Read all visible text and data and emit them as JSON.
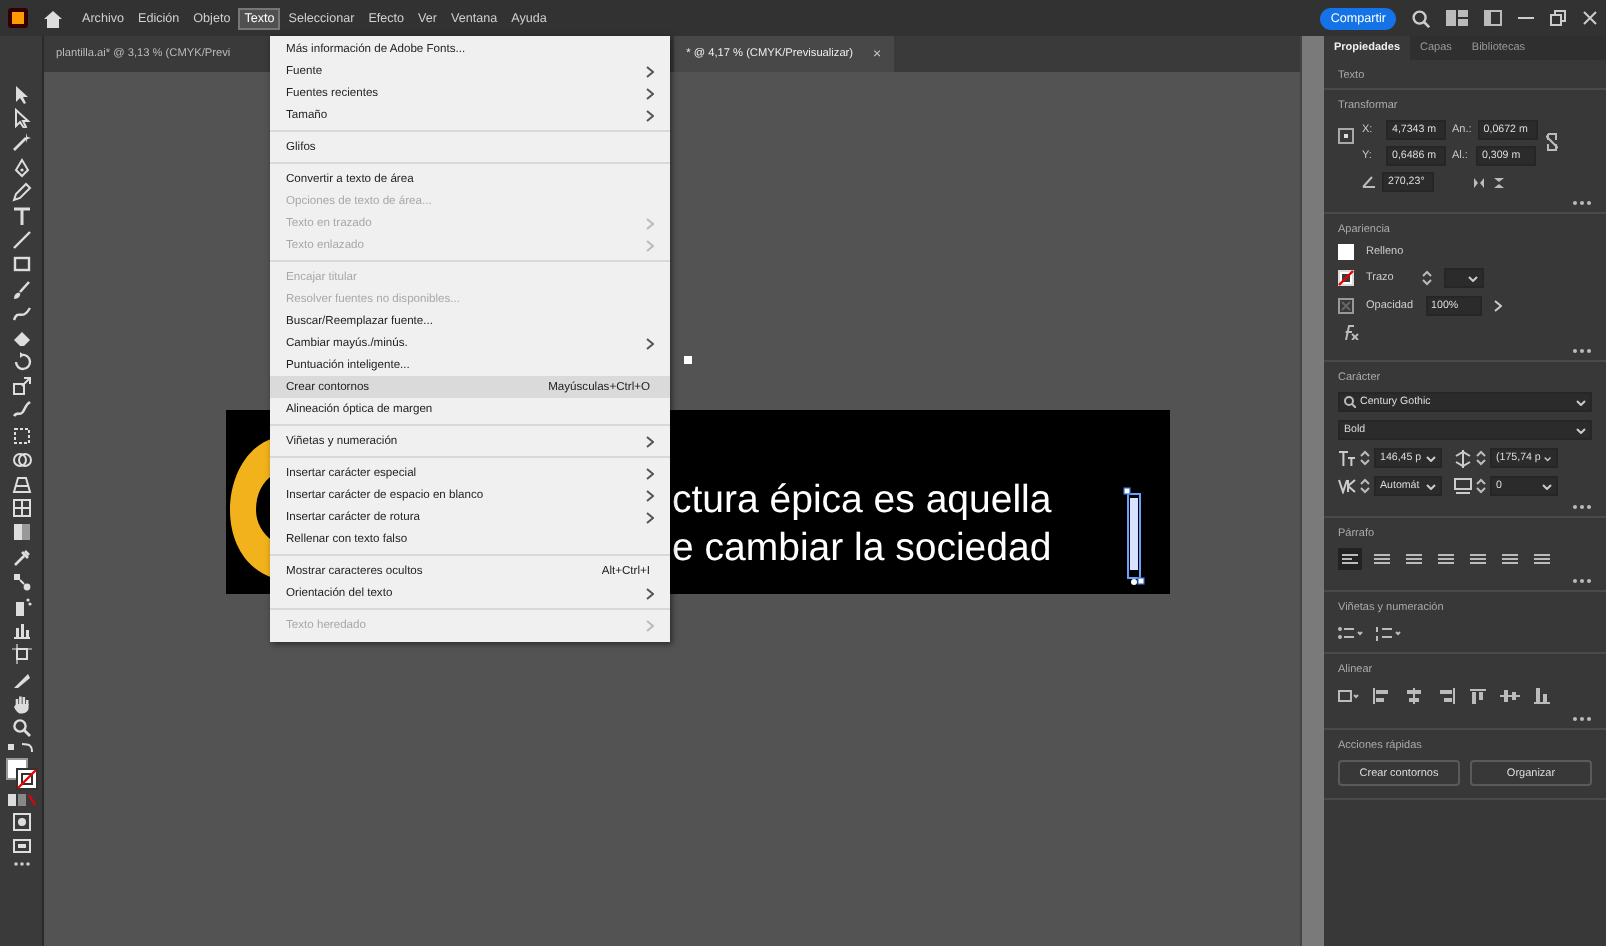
{
  "menubar": {
    "items": [
      {
        "label": "Archivo",
        "selected": false
      },
      {
        "label": "Edición",
        "selected": false
      },
      {
        "label": "Objeto",
        "selected": false
      },
      {
        "label": "Texto",
        "selected": true
      },
      {
        "label": "Seleccionar",
        "selected": false
      },
      {
        "label": "Efecto",
        "selected": false
      },
      {
        "label": "Ver",
        "selected": false
      },
      {
        "label": "Ventana",
        "selected": false
      },
      {
        "label": "Ayuda",
        "selected": false
      }
    ],
    "share_button": "Compartir"
  },
  "document_tabs": [
    {
      "title": "plantilla.ai* @ 3,13 % (CMYK/Previ",
      "selected": false
    },
    {
      "title": "* @ 4,17 % (CMYK/Previsualizar)",
      "selected": true,
      "close": "×"
    }
  ],
  "menu": {
    "items": [
      {
        "kind": "item",
        "label": "Más información de Adobe Fonts...",
        "disabled": false,
        "submenu": false,
        "selected": false
      },
      {
        "kind": "item",
        "label": "Fuente",
        "disabled": false,
        "submenu": true,
        "selected": false
      },
      {
        "kind": "item",
        "label": "Fuentes recientes",
        "disabled": false,
        "submenu": true,
        "selected": false
      },
      {
        "kind": "item",
        "label": "Tamaño",
        "disabled": false,
        "submenu": true,
        "selected": false
      },
      {
        "kind": "separator"
      },
      {
        "kind": "item",
        "label": "Glifos",
        "disabled": false,
        "submenu": false,
        "selected": false
      },
      {
        "kind": "separator"
      },
      {
        "kind": "item",
        "label": "Convertir a texto de área",
        "disabled": false,
        "submenu": false,
        "selected": false
      },
      {
        "kind": "item",
        "label": "Opciones de texto de área...",
        "disabled": true,
        "submenu": false,
        "selected": false
      },
      {
        "kind": "item",
        "label": "Texto en trazado",
        "disabled": true,
        "submenu": true,
        "selected": false
      },
      {
        "kind": "item",
        "label": "Texto enlazado",
        "disabled": true,
        "submenu": true,
        "selected": false
      },
      {
        "kind": "separator"
      },
      {
        "kind": "item",
        "label": "Encajar titular",
        "disabled": true,
        "submenu": false,
        "selected": false
      },
      {
        "kind": "item",
        "label": "Resolver fuentes no disponibles...",
        "disabled": true,
        "submenu": false,
        "selected": false
      },
      {
        "kind": "item",
        "label": "Buscar/Reemplazar fuente...",
        "disabled": false,
        "submenu": false,
        "selected": false
      },
      {
        "kind": "item",
        "label": "Cambiar mayús./minús.",
        "disabled": false,
        "submenu": true,
        "selected": false
      },
      {
        "kind": "item",
        "label": "Puntuación inteligente...",
        "disabled": false,
        "submenu": false,
        "selected": false
      },
      {
        "kind": "item",
        "label": "Crear contornos",
        "shortcut": "Mayúsculas+Ctrl+O",
        "disabled": false,
        "submenu": false,
        "selected": true
      },
      {
        "kind": "item",
        "label": "Alineación óptica de margen",
        "disabled": false,
        "submenu": false,
        "selected": false
      },
      {
        "kind": "separator"
      },
      {
        "kind": "item",
        "label": "Viñetas y numeración",
        "disabled": false,
        "submenu": true,
        "selected": false
      },
      {
        "kind": "separator"
      },
      {
        "kind": "item",
        "label": "Insertar carácter especial",
        "disabled": false,
        "submenu": true,
        "selected": false
      },
      {
        "kind": "item",
        "label": "Insertar carácter de espacio en blanco",
        "disabled": false,
        "submenu": true,
        "selected": false
      },
      {
        "kind": "item",
        "label": "Insertar carácter de rotura",
        "disabled": false,
        "submenu": true,
        "selected": false
      },
      {
        "kind": "item",
        "label": "Rellenar con texto falso",
        "disabled": false,
        "submenu": false,
        "selected": false
      },
      {
        "kind": "separator"
      },
      {
        "kind": "item",
        "label": "Mostrar caracteres ocultos",
        "shortcut": "Alt+Ctrl+I",
        "disabled": false,
        "submenu": false,
        "selected": false
      },
      {
        "kind": "item",
        "label": "Orientación del texto",
        "disabled": false,
        "submenu": true,
        "selected": false
      },
      {
        "kind": "separator"
      },
      {
        "kind": "item",
        "label": "Texto heredado",
        "disabled": true,
        "submenu": true,
        "selected": false
      }
    ]
  },
  "canvas": {
    "text_lines": [
      "ctura épica es aquella",
      "e cambiar la sociedad"
    ]
  },
  "properties": {
    "tabs": [
      {
        "label": "Propiedades",
        "selected": true
      },
      {
        "label": "Capas",
        "selected": false
      },
      {
        "label": "Bibliotecas",
        "selected": false
      }
    ],
    "text_heading": "Texto",
    "transform": {
      "title": "Transformar",
      "x_label": "X:",
      "x": "4,7343 m",
      "w_label": "An.:",
      "w": "0,0672 m",
      "y_label": "Y:",
      "y": "0,6486 m",
      "h_label": "Al.:",
      "h": "0,309 m",
      "angle": "270,23°"
    },
    "appearance": {
      "title": "Apariencia",
      "fill_label": "Relleno",
      "stroke_label": "Trazo",
      "opacity_label": "Opacidad",
      "opacity": "100%"
    },
    "character": {
      "title": "Carácter",
      "font": "Century Gothic",
      "style": "Bold",
      "size": "146,45 p",
      "leading": "(175,74 p",
      "kerning": "Automát",
      "tracking": "0"
    },
    "paragraph": {
      "title": "Párrafo",
      "alignments": [
        {
          "selected": true
        },
        {
          "selected": false
        },
        {
          "selected": false
        },
        {
          "selected": false
        },
        {
          "selected": false
        },
        {
          "selected": false
        },
        {
          "selected": false
        }
      ]
    },
    "bullets": {
      "title": "Viñetas y numeración"
    },
    "align": {
      "title": "Alinear"
    },
    "quick_actions": {
      "title": "Acciones rápidas",
      "buttons": [
        "Crear contornos",
        "Organizar"
      ]
    }
  }
}
